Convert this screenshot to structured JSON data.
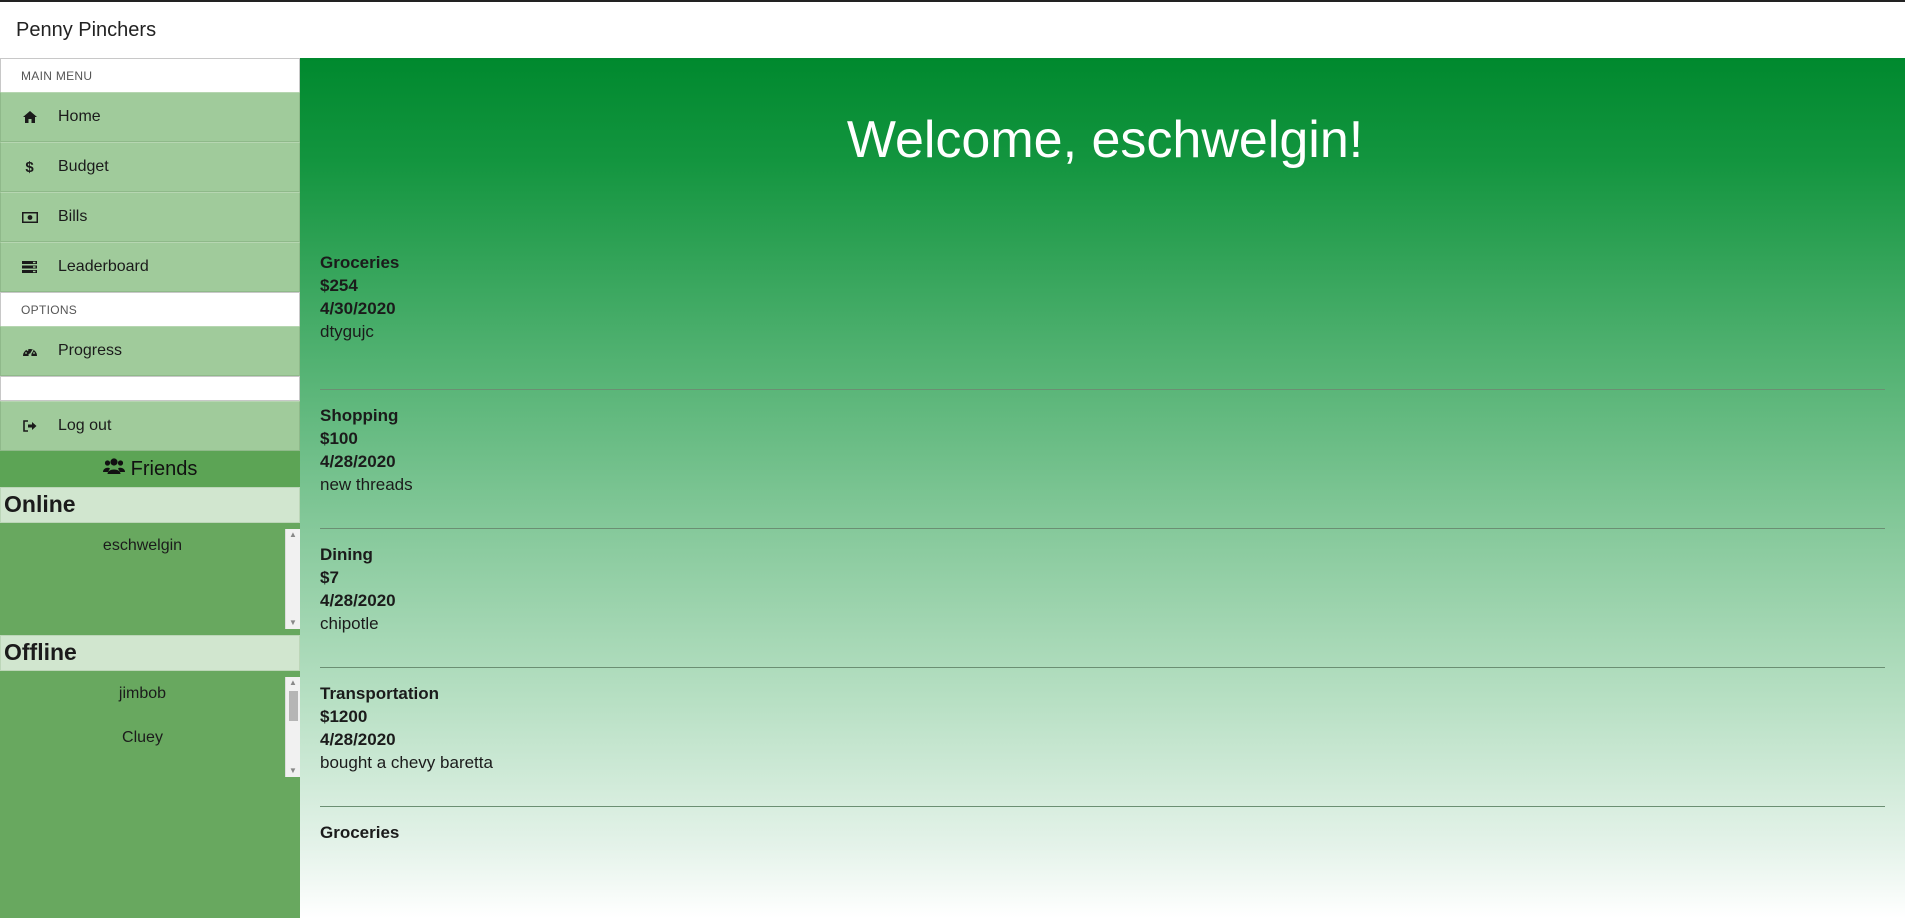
{
  "app": {
    "title": "Penny Pinchers"
  },
  "sidebar": {
    "main_menu_header": "MAIN MENU",
    "items": [
      {
        "label": "Home",
        "icon": "home-icon"
      },
      {
        "label": "Budget",
        "icon": "dollar-icon"
      },
      {
        "label": "Bills",
        "icon": "money-bill-icon"
      },
      {
        "label": "Leaderboard",
        "icon": "list-icon"
      }
    ],
    "options_header": "OPTIONS",
    "options": [
      {
        "label": "Progress",
        "icon": "tachometer-icon"
      }
    ],
    "logout": {
      "label": "Log out",
      "icon": "sign-out-icon"
    }
  },
  "friends": {
    "title": "Friends",
    "online_title": "Online",
    "online": [
      "eschwelgin"
    ],
    "offline_title": "Offline",
    "offline": [
      "jimbob",
      "Cluey"
    ]
  },
  "main": {
    "welcome": "Welcome, eschwelgin!",
    "transactions": [
      {
        "category": "Groceries",
        "amount": "$254",
        "date": "4/30/2020",
        "note": "dtygujc"
      },
      {
        "category": "Shopping",
        "amount": "$100",
        "date": "4/28/2020",
        "note": "new threads"
      },
      {
        "category": "Dining",
        "amount": "$7",
        "date": "4/28/2020",
        "note": "chipotle"
      },
      {
        "category": "Transportation",
        "amount": "$1200",
        "date": "4/28/2020",
        "note": "bought a chevy baretta"
      },
      {
        "category": "Groceries"
      }
    ]
  },
  "colors": {
    "sidebar_bg": "#68a85f",
    "menu_item_bg": "#a0cb9b",
    "gradient_top": "#00892e",
    "gradient_bottom": "#ffffff"
  }
}
